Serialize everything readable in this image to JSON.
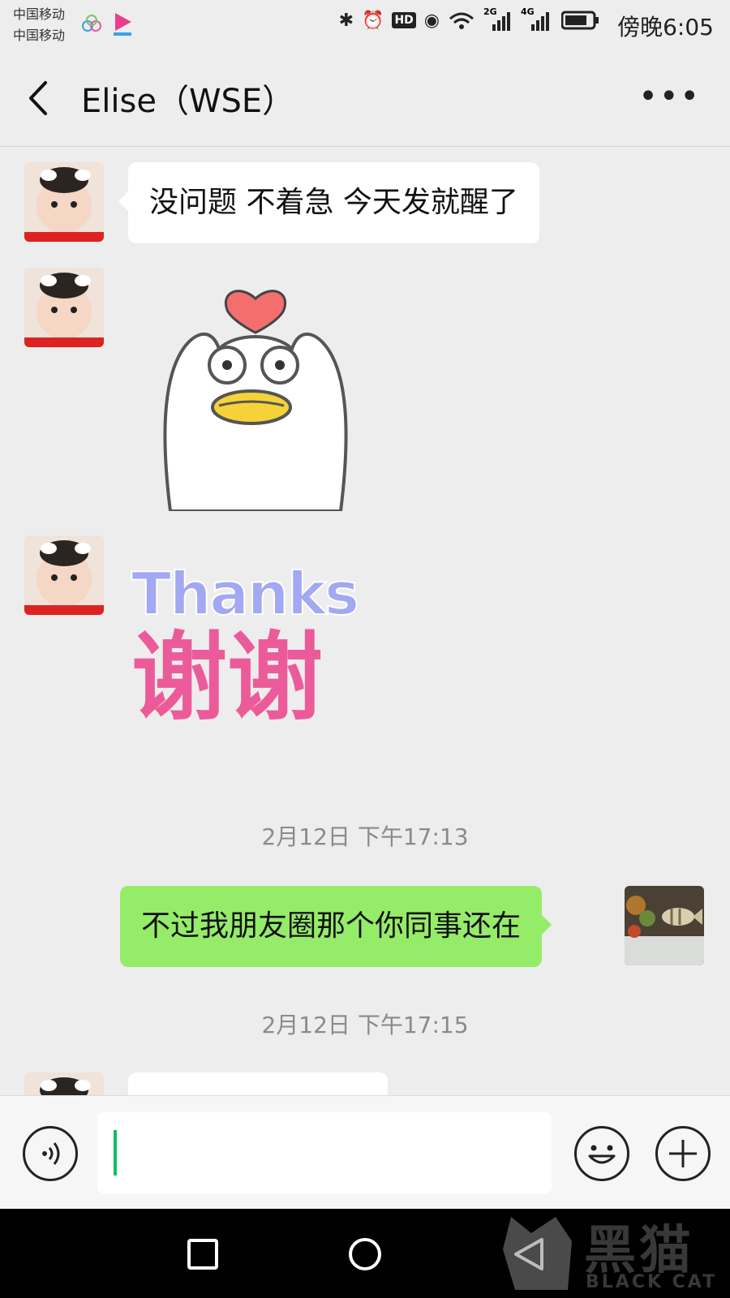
{
  "status_bar": {
    "carrier1": "中国移动",
    "carrier2": "中国移动",
    "net_2g": "2G",
    "net_4g": "4G",
    "hd": "HD",
    "time": "傍晚6:05"
  },
  "header": {
    "title": "Elise（WSE）",
    "more_label": "•••"
  },
  "messages": [
    {
      "type": "text",
      "side": "left",
      "text": "没问题 不着急 今天发就醒了"
    },
    {
      "type": "sticker",
      "side": "left",
      "sticker": "duck-heart-sticker"
    },
    {
      "type": "sticker",
      "side": "left",
      "sticker": "thanks-sticker",
      "line1": "Thanks",
      "line2": "谢谢"
    },
    {
      "type": "timestamp",
      "text": "2月12日 下午17:13"
    },
    {
      "type": "text",
      "side": "right",
      "text": "不过我朋友圈那个你同事还在"
    },
    {
      "type": "timestamp",
      "text": "2月12日 下午17:15"
    }
  ],
  "colors": {
    "background": "#ededed",
    "self_bubble": "#95ec69",
    "other_bubble": "#ffffff",
    "caret": "#07c160"
  },
  "watermark": {
    "brand": "黑猫",
    "sub": "BLACK CAT"
  }
}
